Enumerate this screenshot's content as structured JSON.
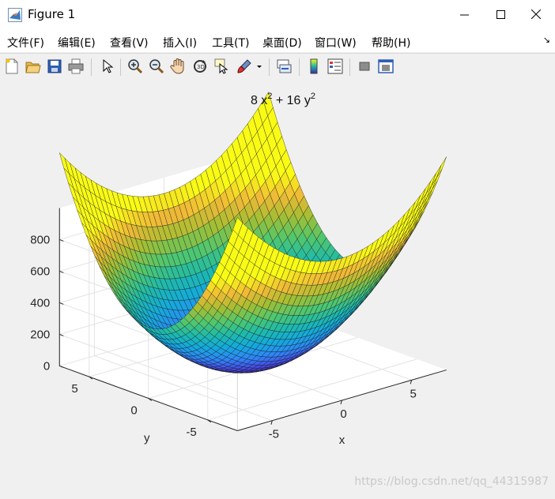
{
  "window": {
    "title": "Figure 1"
  },
  "menu": [
    "文件(F)",
    "编辑(E)",
    "查看(V)",
    "插入(I)",
    "工具(T)",
    "桌面(D)",
    "窗口(W)",
    "帮助(H)"
  ],
  "toolbar": {
    "icons": [
      "new-figure-icon",
      "open-icon",
      "save-icon",
      "print-icon",
      "select-arrow-icon",
      "zoom-in-icon",
      "zoom-out-icon",
      "pan-hand-icon",
      "rotate-3d-icon",
      "data-cursor-icon",
      "brush-icon",
      "brush-dropdown-icon",
      "link-plot-icon",
      "colorbar-icon",
      "legend-icon",
      "hide-plot-tools-icon",
      "show-plot-tools-icon"
    ]
  },
  "chart_data": {
    "type": "surface",
    "function": "z = 8x^2 + 16y^2",
    "title_parts": [
      "8 x",
      "2",
      " + 16 y",
      "2"
    ],
    "xlabel": "x",
    "ylabel": "y",
    "zlabel": "",
    "xlim": [
      -7.5,
      7.5
    ],
    "ylim": [
      -7.5,
      7.5
    ],
    "zlim": [
      0,
      1000
    ],
    "x_ticks": [
      "-5",
      "0",
      "5"
    ],
    "y_ticks": [
      "-5",
      "0",
      "5"
    ],
    "z_ticks": [
      "0",
      "200",
      "400",
      "600",
      "800"
    ],
    "x_tick_values": [
      -5,
      0,
      5
    ],
    "y_tick_values": [
      -5,
      0,
      5
    ],
    "z_tick_values": [
      0,
      200,
      400,
      600,
      800
    ],
    "grid_points": 41,
    "colormap": "parula",
    "grid": true
  },
  "watermark": "https://blog.csdn.net/qq_44315987"
}
